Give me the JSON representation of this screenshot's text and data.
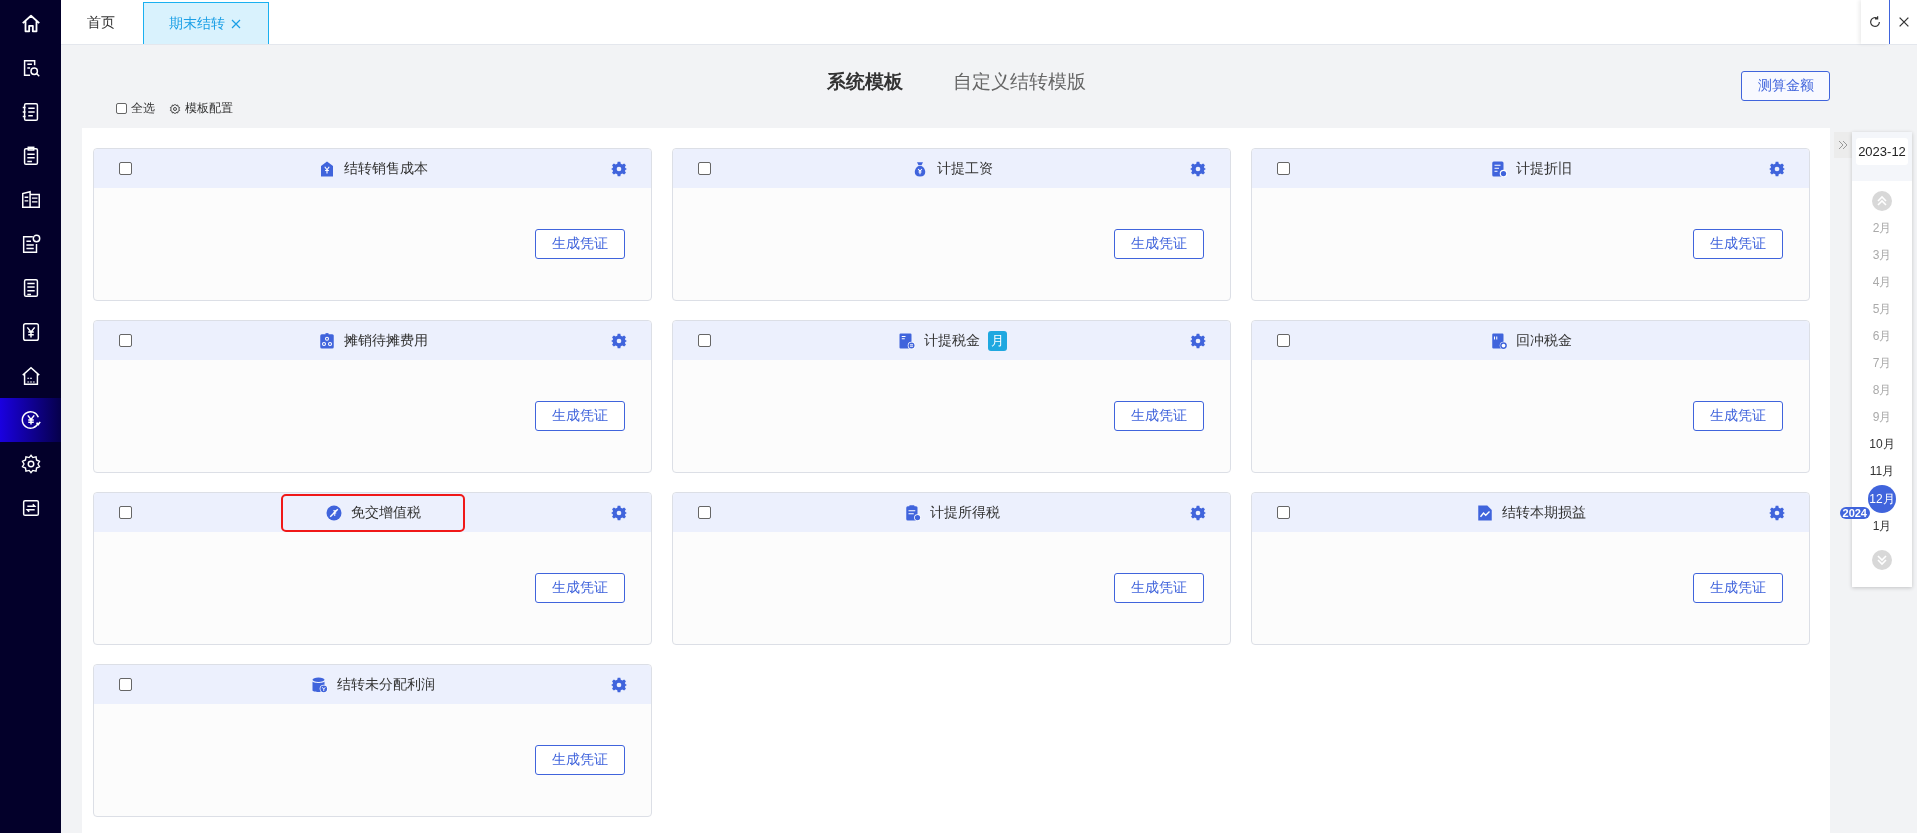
{
  "sidebar": {
    "items": [
      {
        "kind": "home",
        "selected": false
      },
      {
        "kind": "search-doc",
        "selected": false
      },
      {
        "kind": "notebook",
        "selected": false
      },
      {
        "kind": "clipboard",
        "selected": false
      },
      {
        "kind": "books",
        "selected": false
      },
      {
        "kind": "doc-coin",
        "selected": false
      },
      {
        "kind": "doc",
        "selected": false
      },
      {
        "kind": "yen",
        "selected": false
      },
      {
        "kind": "house",
        "selected": false
      },
      {
        "kind": "yen-circle",
        "selected": true
      },
      {
        "kind": "gear",
        "selected": false
      },
      {
        "kind": "transfer",
        "selected": false
      }
    ]
  },
  "tabs": [
    {
      "label": "首页",
      "selected": false,
      "closable": false
    },
    {
      "label": "期末结转",
      "selected": true,
      "closable": true
    }
  ],
  "mode_tabs": [
    {
      "label": "系统模板",
      "selected": true
    },
    {
      "label": "自定义结转模版",
      "selected": false
    }
  ],
  "select_all": {
    "label": "全选",
    "checked": false
  },
  "template_config": {
    "label": "模板配置"
  },
  "estimate_button": "测算金额",
  "cards": [
    {
      "title": "结转销售成本",
      "kind": "tag",
      "checked": false,
      "settings": true,
      "highlighted": false,
      "button": "生成凭证"
    },
    {
      "title": "计提工资",
      "kind": "moneybag",
      "checked": false,
      "settings": true,
      "highlighted": false,
      "button": "生成凭证"
    },
    {
      "title": "计提折旧",
      "kind": "doc-gear",
      "checked": false,
      "settings": true,
      "highlighted": false,
      "button": "生成凭证"
    },
    {
      "title": "摊销待摊费用",
      "kind": "org",
      "checked": false,
      "settings": true,
      "highlighted": false,
      "button": "生成凭证"
    },
    {
      "title": "计提税金",
      "kind": "tax-doc",
      "checked": false,
      "settings": true,
      "highlighted": false,
      "tag": "月",
      "button": "生成凭证"
    },
    {
      "title": "回冲税金",
      "kind": "tax-gear",
      "checked": false,
      "settings": false,
      "highlighted": false,
      "button": "生成凭证"
    },
    {
      "title": "免交增值税",
      "kind": "percent",
      "checked": false,
      "settings": true,
      "highlighted": true,
      "button": "生成凭证"
    },
    {
      "title": "计提所得税",
      "kind": "clipboard",
      "checked": false,
      "settings": true,
      "highlighted": false,
      "button": "生成凭证"
    },
    {
      "title": "结转本期损益",
      "kind": "chart",
      "checked": false,
      "settings": true,
      "highlighted": false,
      "button": "生成凭证"
    },
    {
      "title": "结转未分配利润",
      "kind": "coins",
      "checked": false,
      "settings": true,
      "highlighted": false,
      "button": "生成凭证"
    }
  ],
  "period": {
    "current": "2023-12",
    "months": [
      {
        "label": "2月",
        "disabled": true,
        "selected": false
      },
      {
        "label": "3月",
        "disabled": true,
        "selected": false
      },
      {
        "label": "4月",
        "disabled": true,
        "selected": false
      },
      {
        "label": "5月",
        "disabled": true,
        "selected": false
      },
      {
        "label": "6月",
        "disabled": true,
        "selected": false
      },
      {
        "label": "7月",
        "disabled": true,
        "selected": false
      },
      {
        "label": "8月",
        "disabled": true,
        "selected": false
      },
      {
        "label": "9月",
        "disabled": true,
        "selected": false
      },
      {
        "label": "10月",
        "disabled": false,
        "selected": false
      },
      {
        "label": "11月",
        "disabled": false,
        "selected": false
      },
      {
        "label": "12月",
        "disabled": false,
        "selected": true
      },
      {
        "label": "1月",
        "disabled": false,
        "selected": false,
        "year": "2024"
      }
    ]
  }
}
